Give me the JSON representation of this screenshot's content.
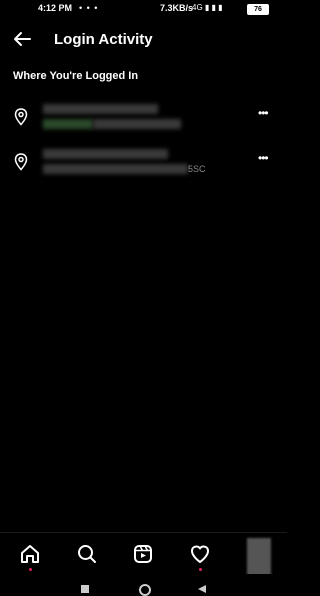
{
  "status_bar": {
    "time": "4:12 PM",
    "notification_icons": "• • •",
    "net_speed": "7.3KB/s",
    "right_icons": "4G ▮ ▮ ▮",
    "battery": "76"
  },
  "header": {
    "title": "Login Activity",
    "back_icon": "arrow-left-icon"
  },
  "section_title": "Where You're Logged In",
  "sessions": [
    {
      "location_icon": "location-pin-icon",
      "suffix": "",
      "more_icon": "more-horizontal-icon"
    },
    {
      "location_icon": "location-pin-icon",
      "suffix": "5SC",
      "more_icon": "more-horizontal-icon"
    }
  ],
  "bottom_nav": {
    "items": [
      {
        "name": "home",
        "icon": "home-icon",
        "active": true
      },
      {
        "name": "search",
        "icon": "search-icon"
      },
      {
        "name": "reels",
        "icon": "reels-icon"
      },
      {
        "name": "activity",
        "icon": "heart-icon",
        "notification": true
      },
      {
        "name": "profile",
        "icon": "avatar"
      }
    ]
  },
  "colors": {
    "background": "#000000",
    "text": "#ffffff",
    "badge": "#e0245e"
  }
}
